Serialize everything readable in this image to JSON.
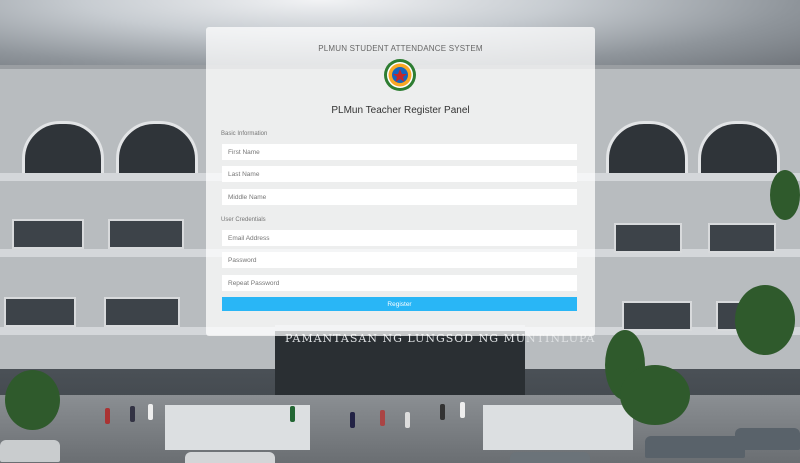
{
  "system_title": "PLMUN STUDENT ATTENDANCE SYSTEM",
  "logo_icon": "plmun-seal-icon",
  "panel_title": "PLMun Teacher Register Panel",
  "sections": {
    "basic_info": "Basic Information",
    "user_credentials": "User Credentials"
  },
  "fields": {
    "first_name": {
      "placeholder": "First Name",
      "value": ""
    },
    "last_name": {
      "placeholder": "Last Name",
      "value": ""
    },
    "middle_name": {
      "placeholder": "Middle Name",
      "value": ""
    },
    "email": {
      "placeholder": "Email Address",
      "value": ""
    },
    "password": {
      "placeholder": "Password",
      "value": ""
    },
    "repeat_password": {
      "placeholder": "Repeat Password",
      "value": ""
    }
  },
  "register_button": "Register",
  "building_sign": "PAMANTASAN NG LUNGSOD NG MUNTINLUPA",
  "colors": {
    "accent": "#29b6f6",
    "panel": "rgba(255,255,255,0.74)"
  }
}
